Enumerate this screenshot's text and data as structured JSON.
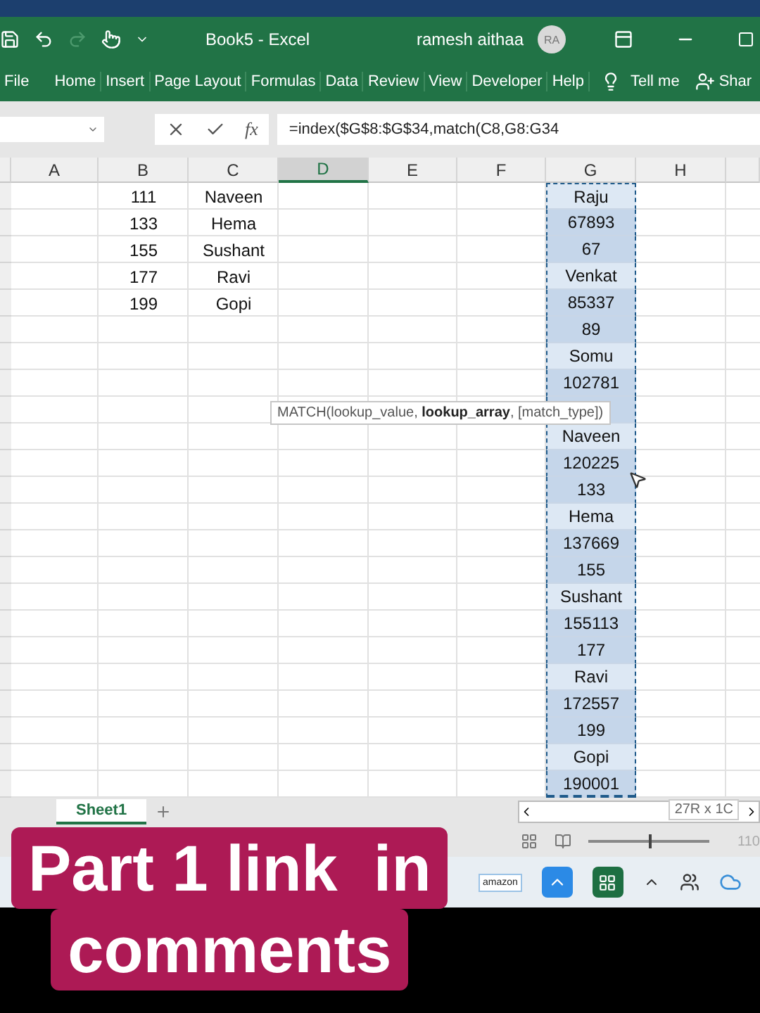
{
  "window": {
    "title": "Book5  -  Excel",
    "user": "ramesh aithaa",
    "avatar": "RA"
  },
  "ribbon": {
    "tabs": [
      "File",
      "Home",
      "Insert",
      "Page Layout",
      "Formulas",
      "Data",
      "Review",
      "View",
      "Developer",
      "Help"
    ],
    "tell_me": "Tell me",
    "share": "Shar"
  },
  "formula_bar": {
    "fx_label": "fx",
    "formula": "=index($G$8:$G$34,match(C8,G8:G34"
  },
  "columns": [
    {
      "label": "A",
      "selected": false
    },
    {
      "label": "B",
      "selected": false
    },
    {
      "label": "C",
      "selected": false
    },
    {
      "label": "D",
      "selected": true
    },
    {
      "label": "E",
      "selected": false
    },
    {
      "label": "F",
      "selected": false
    },
    {
      "label": "G",
      "selected": false
    },
    {
      "label": "H",
      "selected": false
    }
  ],
  "rows": [
    {
      "B": "111",
      "C": "Naveen",
      "G": "Raju"
    },
    {
      "B": "133",
      "C": "Hema",
      "G": "67893"
    },
    {
      "B": "155",
      "C": "Sushant",
      "G": "67"
    },
    {
      "B": "177",
      "C": "Ravi",
      "G": "Venkat"
    },
    {
      "B": "199",
      "C": "Gopi",
      "G": "85337"
    },
    {
      "G": "89"
    },
    {
      "G": "Somu"
    },
    {
      "G": "102781"
    },
    {},
    {
      "G": "Naveen"
    },
    {
      "G": "120225"
    },
    {
      "G": "133"
    },
    {
      "G": "Hema"
    },
    {
      "G": "137669"
    },
    {
      "G": "155"
    },
    {
      "G": "Sushant"
    },
    {
      "G": "155113"
    },
    {
      "G": "177"
    },
    {
      "G": "Ravi"
    },
    {
      "G": "172557"
    },
    {
      "G": "199"
    },
    {
      "G": "Gopi"
    },
    {
      "G": "190001"
    }
  ],
  "tooltip": "MATCH(lookup_value, **lookup_array**, [match_type])",
  "sheet_tabs": [
    {
      "label": "Sheet1",
      "selected": true
    }
  ],
  "selection_info": "27R x 1C",
  "status_bar": {
    "zoom": "110",
    "zoom_slider": {
      "level": 0.5
    }
  },
  "taskbar": {
    "amazon_label": "amazon"
  },
  "caption": [
    "Part 1 link  in",
    "comments"
  ]
}
